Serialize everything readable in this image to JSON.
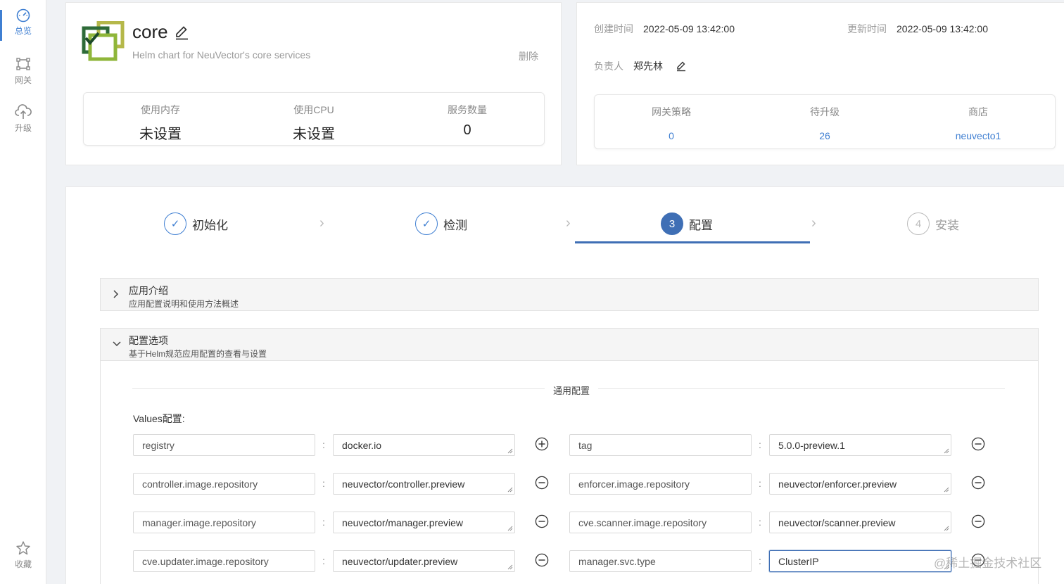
{
  "sidebar": {
    "items": [
      {
        "label": "总览",
        "icon": "dashboard-icon",
        "active": true
      },
      {
        "label": "网关",
        "icon": "gateway-icon",
        "active": false
      },
      {
        "label": "升级",
        "icon": "cloud-upload-icon",
        "active": false
      },
      {
        "label": "收藏",
        "icon": "star-icon",
        "active": false
      }
    ]
  },
  "app": {
    "name": "core",
    "description": "Helm chart for NeuVector's core services",
    "delete_label": "删除",
    "stats": [
      {
        "label": "使用内存",
        "value": "未设置"
      },
      {
        "label": "使用CPU",
        "value": "未设置"
      },
      {
        "label": "服务数量",
        "value": "0"
      }
    ]
  },
  "meta": {
    "created_label": "创建时间",
    "created_value": "2022-05-09 13:42:00",
    "updated_label": "更新时间",
    "updated_value": "2022-05-09 13:42:00",
    "owner_label": "负责人",
    "owner_value": "郑先林",
    "stats": [
      {
        "label": "网关策略",
        "value": "0"
      },
      {
        "label": "待升级",
        "value": "26"
      },
      {
        "label": "商店",
        "value": "neuvecto1"
      }
    ]
  },
  "steps": [
    {
      "label": "初始化",
      "state": "done",
      "marker": "✓"
    },
    {
      "label": "检测",
      "state": "done",
      "marker": "✓"
    },
    {
      "label": "配置",
      "state": "current",
      "marker": "3"
    },
    {
      "label": "安装",
      "state": "pending",
      "marker": "4"
    }
  ],
  "panels": {
    "intro": {
      "title": "应用介绍",
      "subtitle": "应用配置说明和使用方法概述"
    },
    "options": {
      "title": "配置选项",
      "subtitle": "基于Helm规范应用配置的查看与设置"
    }
  },
  "config": {
    "section_label": "通用配置",
    "values_label": "Values配置:",
    "rows": [
      {
        "left_key": "registry",
        "left_value": "docker.io",
        "left_action": "add",
        "right_key": "tag",
        "right_value": "5.0.0-preview.1",
        "right_action": "remove"
      },
      {
        "left_key": "controller.image.repository",
        "left_value": "neuvector/controller.preview",
        "left_action": "remove",
        "right_key": "enforcer.image.repository",
        "right_value": "neuvector/enforcer.preview",
        "right_action": "remove"
      },
      {
        "left_key": "manager.image.repository",
        "left_value": "neuvector/manager.preview",
        "left_action": "remove",
        "right_key": "cve.scanner.image.repository",
        "right_value": "neuvector/scanner.preview",
        "right_action": "remove"
      },
      {
        "left_key": "cve.updater.image.repository",
        "left_value": "neuvector/updater.preview",
        "left_action": "remove",
        "right_key": "manager.svc.type",
        "right_value": "ClusterIP",
        "right_action": "remove"
      }
    ]
  },
  "watermark": "@稀土掘金技术社区",
  "colors": {
    "accent": "#3f6fb5",
    "link": "#3f7fd2",
    "logo_green": "#5a9e2f",
    "logo_olive": "#b5b84a"
  }
}
